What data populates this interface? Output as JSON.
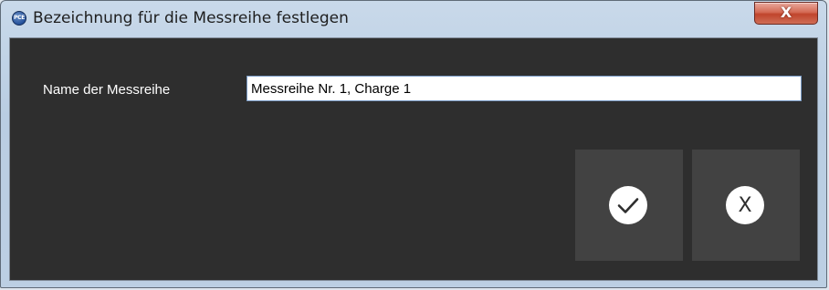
{
  "window": {
    "title": "Bezeichnung für die Messreihe festlegen",
    "app_icon": "pce-logo-icon",
    "app_icon_text": "PCE",
    "close_label": "X"
  },
  "form": {
    "label": "Name der Messreihe",
    "value": "Messreihe Nr. 1, Charge 1"
  },
  "buttons": {
    "ok_icon": "checkmark-icon",
    "cancel_icon": "x-icon",
    "cancel_glyph": "X"
  },
  "colors": {
    "client_background": "#2e2e2e",
    "button_background": "#424242",
    "icon_circle": "#ffffff"
  }
}
